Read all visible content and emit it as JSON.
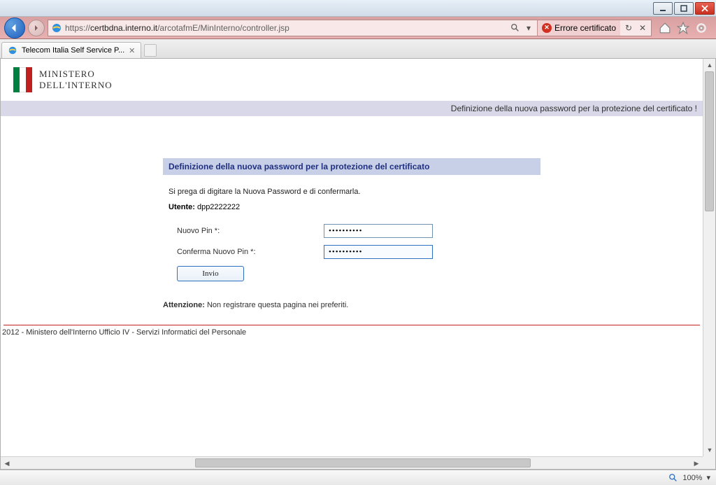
{
  "window": {
    "min": "_",
    "max": "❐",
    "close": "✕"
  },
  "address": {
    "scheme": "https://",
    "host": "certbdna.interno.it",
    "path": "/arcotafmE/MinInterno/controller.jsp",
    "cert_error": "Errore certificato"
  },
  "tab": {
    "title": "Telecom Italia Self Service P..."
  },
  "page": {
    "logo_line1": "MINISTERO",
    "logo_line2": "DELL'INTERNO",
    "banner": "Definizione della nuova password per la protezione del certificato !",
    "form_title": "Definizione della nuova password per la protezione del certificato",
    "instruction": "Si prega di digitare la Nuova Password e di confermarla.",
    "user_label": "Utente:",
    "user_value": "dpp2222222",
    "new_pin_label": "Nuovo Pin *:",
    "new_pin_value": "••••••••••",
    "confirm_pin_label": "Conferma Nuovo Pin *:",
    "confirm_pin_value": "••••••••••",
    "submit": "Invio",
    "attention_label": "Attenzione:",
    "attention_text": " Non registrare questa pagina nei preferiti.",
    "footer": "2012 - Ministero dell'Interno Ufficio IV - Servizi Informatici del Personale"
  },
  "status": {
    "zoom": "100%"
  }
}
